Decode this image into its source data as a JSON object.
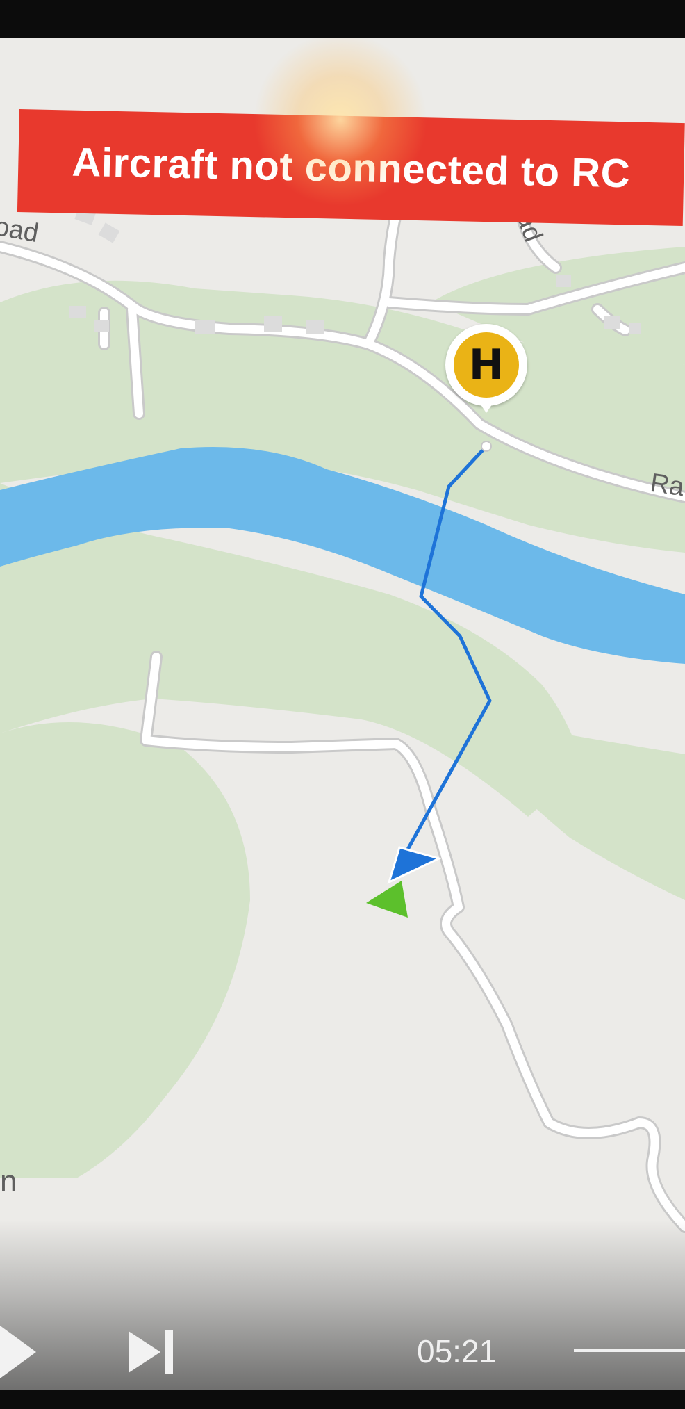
{
  "alert": {
    "text": "Aircraft not connected to RC"
  },
  "map": {
    "labels": [
      {
        "id": "road-label-left",
        "text": "oad"
      },
      {
        "id": "road-label-top",
        "text": "ad"
      },
      {
        "id": "road-label-right",
        "text": "Ra"
      },
      {
        "id": "map-label-edge",
        "text": "n"
      }
    ],
    "home_marker": {
      "label": "H",
      "color": "#eab316"
    },
    "flight_path_color": "#1e73d8",
    "aircraft_color": "#5cc02c",
    "river_color": "#6cb9ea",
    "green_area_color": "#d4e3c9"
  },
  "player": {
    "time": "05:21",
    "play_icon": "play-icon",
    "next_icon": "skip-next-icon"
  },
  "colors": {
    "alert_bg": "#e8392d",
    "alert_text": "#ffffff"
  }
}
